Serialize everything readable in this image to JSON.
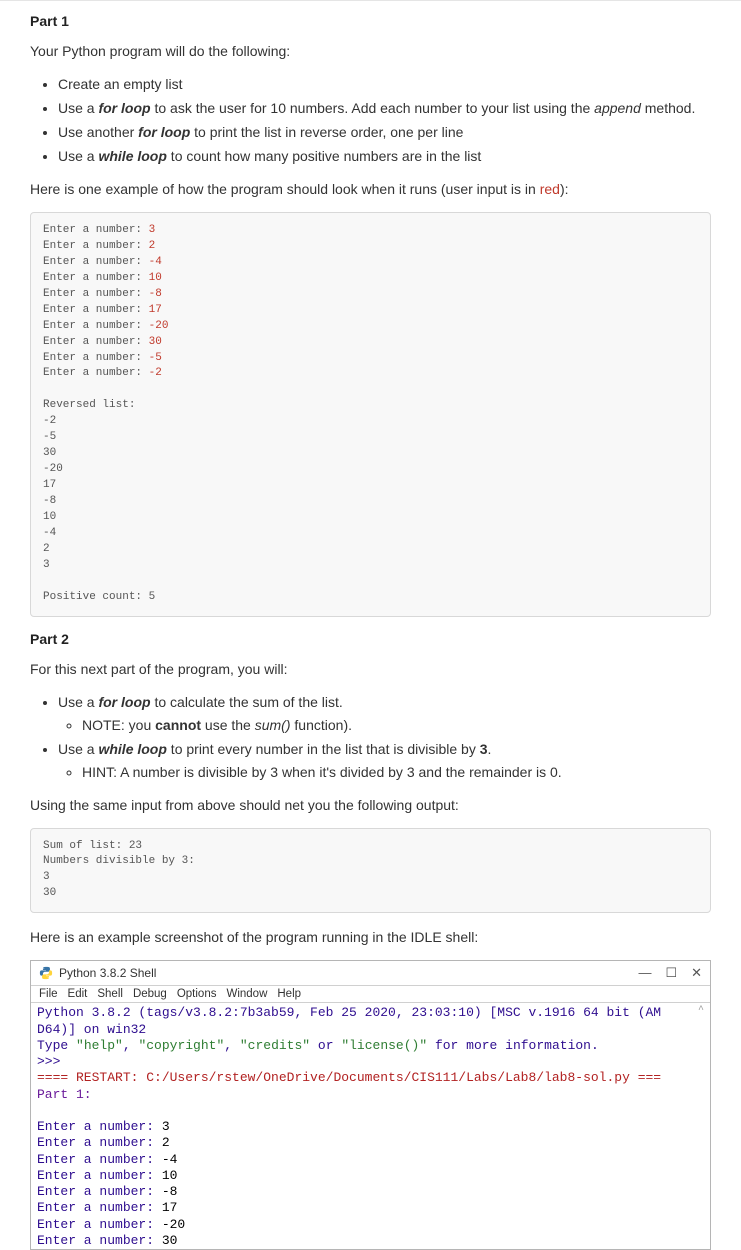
{
  "part1": {
    "heading": "Part 1",
    "intro": "Your Python program will do the following:",
    "bul1": "Create an empty list",
    "bul2_a": "Use a ",
    "bul2_b": "for loop",
    "bul2_c": " to ask the user for 10 numbers. Add each number to your list using the ",
    "bul2_d": "append",
    "bul2_e": " method.",
    "bul3_a": "Use another ",
    "bul3_b": "for loop",
    "bul3_c": " to print the list in reverse order, one per line",
    "bul4_a": "Use a ",
    "bul4_b": "while loop",
    "bul4_c": " to count how many positive numbers are in the list",
    "example_a": "Here is one example of how the program should look when it runs (user input is in ",
    "example_b": "red",
    "example_c": "):",
    "prompt": "Enter a number: ",
    "inputs": [
      "3",
      "2",
      "-4",
      "10",
      "-8",
      "17",
      "-20",
      "30",
      "-5",
      "-2"
    ],
    "rev_label": "Reversed list:",
    "rev": [
      "-2",
      "-5",
      "30",
      "-20",
      "17",
      "-8",
      "10",
      "-4",
      "2",
      "3"
    ],
    "pos_label": "Positive count: 5"
  },
  "part2": {
    "heading": "Part 2",
    "intro": "For this next part of the program, you will:",
    "bul1_a": "Use a ",
    "bul1_b": "for loop",
    "bul1_c": " to calculate the sum of the list.",
    "note_a": "NOTE: you ",
    "note_b": "cannot",
    "note_c": " use the ",
    "note_d": "sum()",
    "note_e": " function).",
    "bul2_a": "Use a ",
    "bul2_b": "while loop",
    "bul2_c": " to print every number in the list that is divisible by ",
    "bul2_d": "3",
    "bul2_e": ".",
    "hint": "HINT: A number is divisible by 3 when it's divided by 3  and the remainder is 0.",
    "same_input": "Using the same input from above should net you the following output:",
    "out_sum": "Sum of list: 23",
    "out_div": "Numbers divisible by 3:",
    "out_d1": "3",
    "out_d2": "30",
    "screenshot_lead": "Here is an example screenshot of the program running in the IDLE shell:"
  },
  "idle": {
    "title": "Python 3.8.2 Shell",
    "menu": [
      "File",
      "Edit",
      "Shell",
      "Debug",
      "Options",
      "Window",
      "Help"
    ],
    "line1a": "Python 3.8.2 (tags/v3.8.2:7b3ab59, Feb 25 2020, 23:03:10) [MSC v.1916 64 bit (AM",
    "line1b": "D64)] on win32",
    "line2a": "Type ",
    "line2_q1": "\"help\"",
    "line2_c1": ", ",
    "line2_q2": "\"copyright\"",
    "line2_c2": ", ",
    "line2_q3": "\"credits\"",
    "line2_or": " or ",
    "line2_q4": "\"license()\"",
    "line2_end": " for more information.",
    "prompt": ">>>",
    "restart": "==== RESTART: C:/Users/rstew/OneDrive/Documents/CIS111/Labs/Lab8/lab8-sol.py ===",
    "part1": "Part 1:",
    "enter": "Enter a number: ",
    "inputs": [
      "3",
      "2",
      "-4",
      "10",
      "-8",
      "17",
      "-20",
      "30"
    ],
    "caret": "^"
  }
}
